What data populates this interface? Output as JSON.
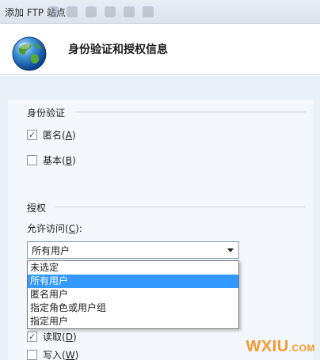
{
  "window": {
    "title": "添加 FTP 站点"
  },
  "header": {
    "title": "身份验证和授权信息",
    "globe_icon": "globe-icon"
  },
  "authentication": {
    "title": "身份验证",
    "anonymous": {
      "text": "匿名",
      "accesskey": "A",
      "checked": true
    },
    "basic": {
      "text": "基本",
      "accesskey": "B",
      "checked": false
    }
  },
  "authorization": {
    "title": "授权",
    "allow_access_label": {
      "text": "允许访问",
      "accesskey": "C"
    },
    "combo_value": "所有用户",
    "options": [
      "未选定",
      "所有用户",
      "匿名用户",
      "指定角色或用户组",
      "指定用户"
    ],
    "selected_index": 1
  },
  "permissions": {
    "read": {
      "text": "读取",
      "accesskey": "D",
      "checked": true
    },
    "write": {
      "text": "写入",
      "accesskey": "W",
      "checked": false
    }
  },
  "watermark": {
    "main": "WXIU",
    "suffix": ".COM"
  },
  "colors": {
    "selection": "#3399ff",
    "content_bg": "#eaf0f7",
    "watermark": "#f29a2e"
  }
}
